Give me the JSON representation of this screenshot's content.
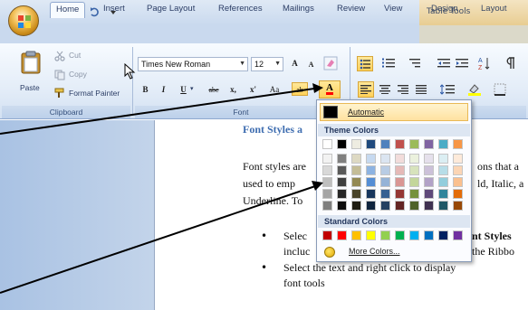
{
  "tabs": {
    "home": "Home",
    "insert": "Insert",
    "page_layout": "Page Layout",
    "references": "References",
    "mailings": "Mailings",
    "review": "Review",
    "view": "View",
    "design": "Design",
    "layout": "Layout"
  },
  "context_header": "Table Tools",
  "clipboard": {
    "paste": "Paste",
    "cut": "Cut",
    "copy": "Copy",
    "format_painter": "Format Painter",
    "group_label": "Clipboard"
  },
  "font": {
    "name": "Times New Roman",
    "size": "12",
    "group_label": "Font",
    "bold": "B",
    "italic": "I",
    "underline": "U",
    "strike": "abc",
    "subscript": "x,",
    "superscript": "x'",
    "change_case": "Aa",
    "grow": "A",
    "shrink": "A",
    "highlight": "ab",
    "color_letter": "A"
  },
  "color_menu": {
    "automatic": "Automatic",
    "theme_colors": "Theme Colors",
    "standard_colors": "Standard Colors",
    "more_colors": "More Colors...",
    "theme_top": [
      "#ffffff",
      "#000000",
      "#eeece1",
      "#1f497d",
      "#4f81bd",
      "#c0504d",
      "#9bbb59",
      "#8064a2",
      "#4bacc6",
      "#f79646"
    ],
    "theme_shades": [
      [
        "#f2f2f2",
        "#7f7f7f",
        "#ddd9c3",
        "#c6d9f0",
        "#dbe5f1",
        "#f2dcdb",
        "#ebf1dd",
        "#e5e0ec",
        "#dbeef3",
        "#fdeada"
      ],
      [
        "#d8d8d8",
        "#595959",
        "#c4bd97",
        "#8db3e2",
        "#b8cce4",
        "#e5b9b7",
        "#d7e3bc",
        "#ccc1d9",
        "#b7dde8",
        "#fbd5b5"
      ],
      [
        "#bfbfbf",
        "#3f3f3f",
        "#938953",
        "#548dd4",
        "#95b3d7",
        "#d99694",
        "#c3d69b",
        "#b2a2c7",
        "#92cddc",
        "#fac08f"
      ],
      [
        "#a5a5a5",
        "#262626",
        "#494429",
        "#17365d",
        "#366092",
        "#953734",
        "#76923c",
        "#5f497a",
        "#31859b",
        "#e36c09"
      ],
      [
        "#7f7f7f",
        "#0c0c0c",
        "#1d1b10",
        "#0f243e",
        "#244061",
        "#632423",
        "#4f6128",
        "#3f3151",
        "#205867",
        "#974806"
      ]
    ],
    "standard": [
      "#c00000",
      "#ff0000",
      "#ffc000",
      "#ffff00",
      "#92d050",
      "#00b050",
      "#00b0f0",
      "#0070c0",
      "#002060",
      "#7030a0"
    ]
  },
  "document": {
    "heading": "Font Styles a",
    "p1_line1_a": "Font styles are",
    "p1_line1_b": "ons that a",
    "p1_line2_a": "used to emp",
    "p1_line2_b": "ld, Italic, a",
    "p1_line3": "Underline.  To",
    "b1_line1_a": "Selec",
    "b1_line1_b": "nt Styles",
    "b1_line2_a": "incluc",
    "b1_line2_b": "the Ribbo",
    "b2_line1": "Select the text and right click to display",
    "b2_line2": "font tools"
  }
}
